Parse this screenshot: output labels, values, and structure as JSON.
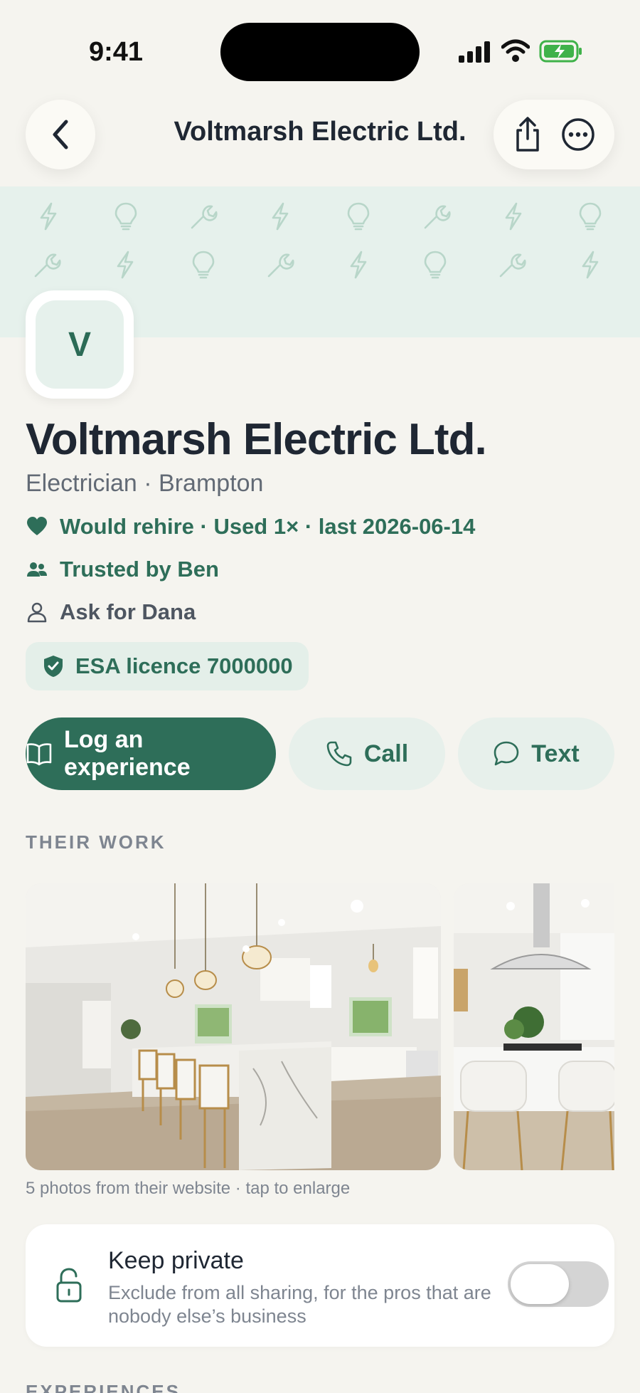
{
  "status_bar": {
    "time": "9:41"
  },
  "nav": {
    "title": "Voltmarsh Electric Ltd."
  },
  "profile": {
    "avatar_letter": "V",
    "name": "Voltmarsh Electric Ltd.",
    "subtitle": "Electrician · Brampton",
    "rehire": "Would rehire · Used 1× · last 2026-06-14",
    "trusted": "Trusted by Ben",
    "contact": "Ask for Dana",
    "licence": "ESA licence 7000000"
  },
  "actions": {
    "log": "Log an experience",
    "call": "Call",
    "text": "Text"
  },
  "work": {
    "label": "THEIR WORK",
    "caption": "5 photos from their website · tap to enlarge"
  },
  "privacy": {
    "title": "Keep private",
    "description": "Exclude from all sharing, for the pros that are nobody else’s business",
    "enabled": false
  },
  "experiences": {
    "label": "EXPERIENCES"
  },
  "colors": {
    "accent": "#2e6e59",
    "banner": "#e6f1ec",
    "background": "#f5f4ef"
  },
  "icons": [
    "chevron-left-icon",
    "share-icon",
    "more-icon",
    "bolt-icon",
    "bulb-icon",
    "wrench-icon",
    "heart-icon",
    "people-icon",
    "person-icon",
    "shield-check-icon",
    "book-icon",
    "phone-icon",
    "chat-icon",
    "unlock-icon"
  ]
}
